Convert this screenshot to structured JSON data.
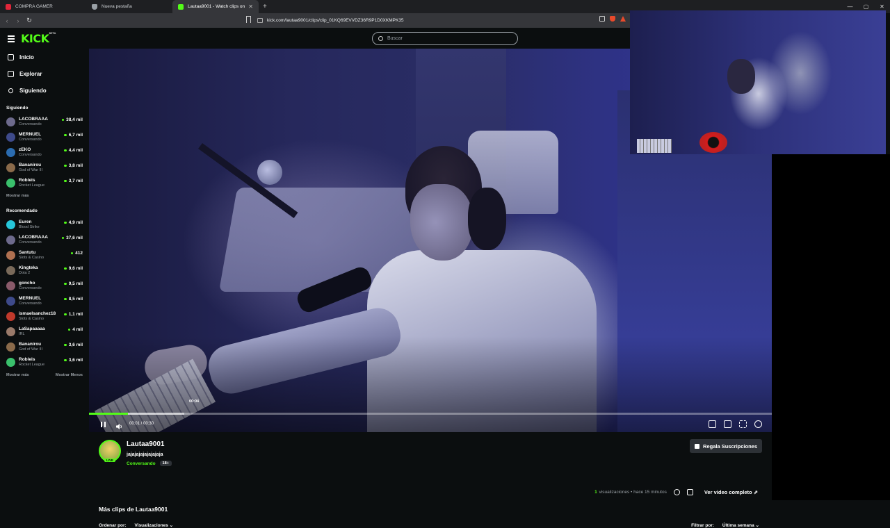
{
  "browser": {
    "tabs": [
      {
        "title": "COMPRA GAMER",
        "color": "#e2263a"
      },
      {
        "title": "Nueva pestaña",
        "color": "#9aa0a6"
      },
      {
        "title": "Lautaa9001 - Watch clips on",
        "color": "#53fc18"
      }
    ],
    "url": "kick.com/lautaa9001/clips/clip_01KQ69EVVDZ36R9P1D0XKMPK35"
  },
  "site": {
    "logo": "KICK",
    "logo_badge": "BETA",
    "search_placeholder": "Buscar"
  },
  "sidebar": {
    "nav": [
      {
        "label": "Inicio",
        "icon": "home-icon"
      },
      {
        "label": "Explorar",
        "icon": "compass-icon"
      },
      {
        "label": "Siguiendo",
        "icon": "heart-icon"
      }
    ],
    "following_title": "Siguiendo",
    "following": [
      {
        "name": "LACOBRAAA",
        "category": "Conversando",
        "viewers": "38,4 mil",
        "color": "#6d6a8c"
      },
      {
        "name": "MERNUEL",
        "category": "Conversando",
        "viewers": "6,7 mil",
        "color": "#3e4a8a"
      },
      {
        "name": "zEKO",
        "category": "Conversando",
        "viewers": "4,4 mil",
        "color": "#2b6cb0"
      },
      {
        "name": "Bananirou",
        "category": "God of War III",
        "viewers": "3,8 mil",
        "color": "#8a6a4a"
      },
      {
        "name": "Robleis",
        "category": "Rocket League",
        "viewers": "3,7 mil",
        "color": "#3ac06c"
      }
    ],
    "following_more": "Mostrar más",
    "recommended_title": "Recomendado",
    "recommended": [
      {
        "name": "Euren",
        "category": "Blood Strike",
        "viewers": "4,9 mil",
        "color": "#26c6da"
      },
      {
        "name": "LACOBRAAA",
        "category": "Conversando",
        "viewers": "37,6 mil",
        "color": "#6d6a8c"
      },
      {
        "name": "Santutu",
        "category": "Slots & Casino",
        "viewers": "412",
        "color": "#b07050"
      },
      {
        "name": "Kingteka",
        "category": "Dota 2",
        "viewers": "9,6 mil",
        "color": "#7a6a5a"
      },
      {
        "name": "goncho",
        "category": "Conversando",
        "viewers": "9,5 mil",
        "color": "#8a5a6a"
      },
      {
        "name": "MERNUEL",
        "category": "Conversando",
        "viewers": "8,5 mil",
        "color": "#3e4a8a"
      },
      {
        "name": "ismaelsanchez18",
        "category": "Slots & Casino",
        "viewers": "1,1 mil",
        "color": "#c0392b"
      },
      {
        "name": "LaSapaaaaa",
        "category": "IRL",
        "viewers": "4 mil",
        "color": "#9a7a6a"
      },
      {
        "name": "Bananirou",
        "category": "God of War III",
        "viewers": "3,6 mil",
        "color": "#8a6a4a"
      },
      {
        "name": "Robleis",
        "category": "Rocket League",
        "viewers": "3,6 mil",
        "color": "#3ac06c"
      }
    ],
    "recommended_more": "Mostrar más",
    "recommended_less": "Mostrar Menos"
  },
  "player": {
    "hover_time": "00:04",
    "time": "00:01 / 00:30",
    "progress_fraction": 0.057,
    "buffer_fraction": 0.14,
    "accent": "#53fc18"
  },
  "clip": {
    "streamer": "Lautaa9001",
    "live_badge": "LIVE",
    "title": "jajajajajajajajaja",
    "category": "Conversando",
    "age": "18+",
    "gift_label": "Regala Suscripciones",
    "views_count": "1",
    "views_label": "visualizaciones",
    "posted": "hace 15 minutos",
    "full_video": "Ver video completo"
  },
  "more_clips": {
    "title": "Más clips de Lautaa9001",
    "sort_label": "Ordenar por:",
    "sort_value": "Visualizaciones",
    "filter_label": "Filtrar por:",
    "filter_value": "Última semana"
  }
}
